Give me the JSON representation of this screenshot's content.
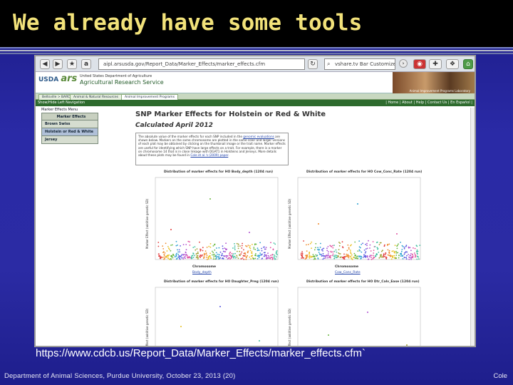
{
  "slide": {
    "title": "We already have some tools",
    "url_caption": "https://www.cdcb.us/Report_Data/Marker_Effects/marker_effects.cfm`",
    "footer_left": "Department of Animal Sciences, Purdue University, October 23, 2013 (20)",
    "footer_right": "Cole"
  },
  "browser": {
    "url": "aipl.arsusda.gov/Report_Data/Marker_Effects/marker_effects.cfm",
    "search_text": "vshare.tv Bar Customize"
  },
  "site": {
    "logo_usda": "USDA",
    "logo_ars": "ars",
    "agency_line1": "United States Department of Agriculture",
    "agency_line2": "Agricultural Research Service",
    "photo_caption": "Animal Improvement Programs Laboratory",
    "tabs": [
      "Beltsville > BARC",
      "Animal & Natural Resources",
      "Animal Improvement Programs"
    ],
    "show_hide": "Show/Hide Left Navigation",
    "top_links": "| Home | About | Help | Contact Us | En Español |"
  },
  "side_nav": {
    "title": "Marker Effects Menu",
    "items": [
      "Marker Effects",
      "Brown Swiss",
      "Holstein or Red & White",
      "Jersey"
    ]
  },
  "page": {
    "h1": "SNP Marker Effects for Holstein or Red & White",
    "h2": "Calculated April 2012",
    "intro_a": "The absolute value of the marker effects for each SNP included in the ",
    "intro_link1": "genomic evaluations",
    "intro_b": " are shown below. Markers on the same chromosome are plotted in the same color and larger versions of each plot may be obtained by clicking on the thumbnail image or the trait name. Marker effects are useful for identifying which SNP have large effects on a trait. For example, there is a marker on chromosome 14 that is in close linkage with DGAT1 in Holsteins and Jerseys. More details about these plots may be found in ",
    "intro_link2": "Cole et al.'s (2009) paper",
    "intro_c": "."
  },
  "plots": [
    {
      "title": "Distribution of marker effects for HO Body_depth (1204 run)",
      "ylabel": "Marker Effect (additive genetic SD)",
      "xlabel": "Chromosome",
      "link": "Body_depth",
      "peaks": [
        12,
        55,
        8
      ]
    },
    {
      "title": "Distribution of marker effects for HO Cow_Conc_Rate (1204 run)",
      "ylabel": "Marker Effect (additive genetic SD)",
      "xlabel": "Chromosome",
      "link": "Cow_Conc_Rate",
      "peaks": [
        20,
        48,
        6
      ]
    },
    {
      "title": "Distribution of marker effects for HO Daughter_Preg (1204 run)",
      "ylabel": "Marker Effect (additive genetic SD)",
      "xlabel": "",
      "link": "",
      "peaks": [
        30,
        58,
        10
      ]
    },
    {
      "title": "Distribution of marker effects for HO Dtr_Calv_Ease (1204 run)",
      "ylabel": "Marker Effect (additive genetic SD)",
      "xlabel": "",
      "link": "",
      "peaks": [
        18,
        50,
        4
      ]
    }
  ],
  "chromosome_colors": [
    "#e23a3a",
    "#f08a2a",
    "#e8c020",
    "#6ab840",
    "#2aa0d0",
    "#5a5ae0",
    "#b050d0",
    "#e050a0",
    "#40c0a0",
    "#a0a030"
  ]
}
